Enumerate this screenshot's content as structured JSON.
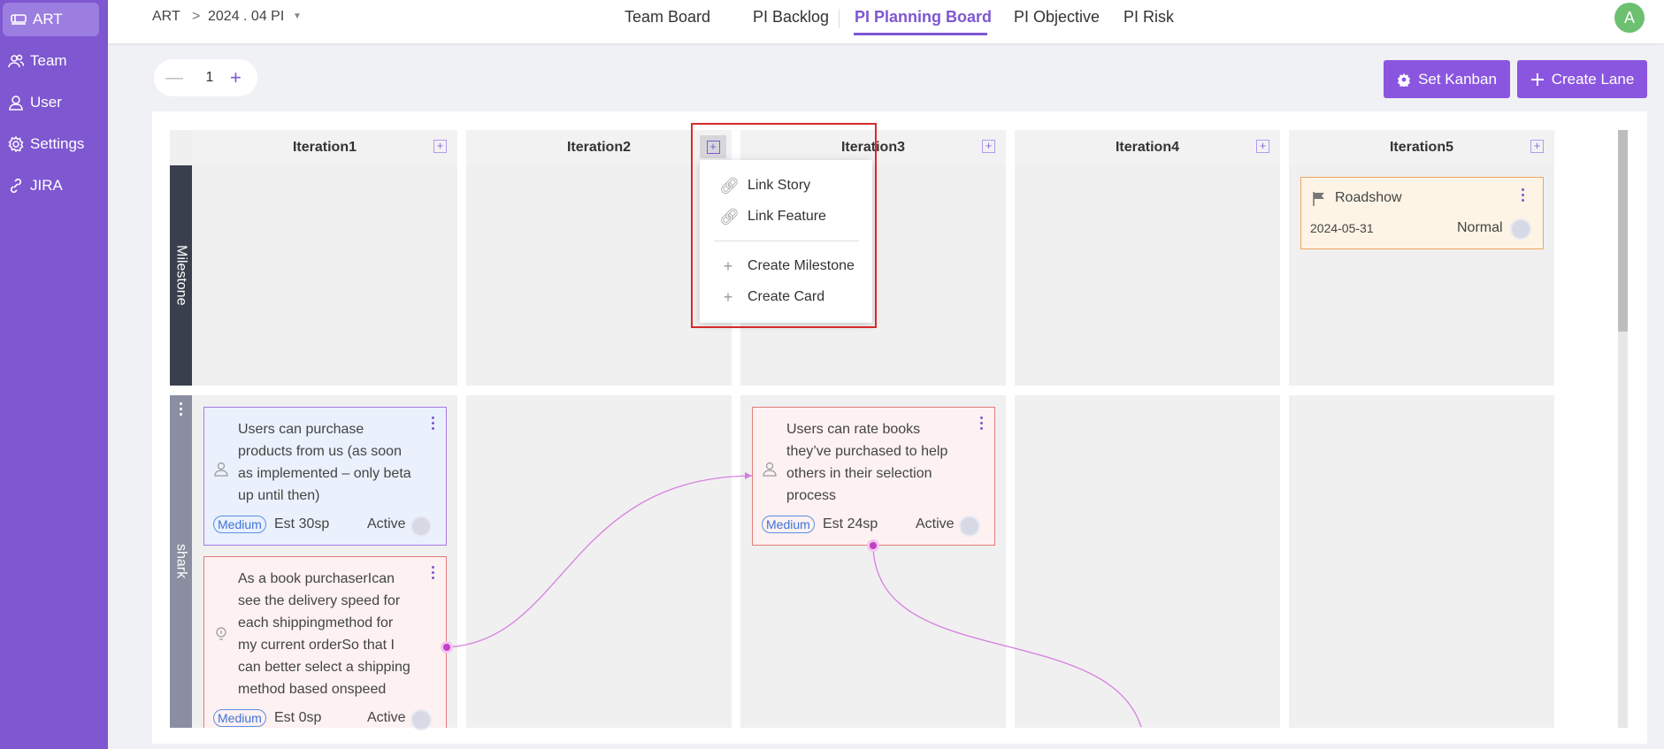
{
  "sidebar": {
    "items": [
      {
        "label": "ART",
        "icon": "train-icon"
      },
      {
        "label": "Team",
        "icon": "team-icon"
      },
      {
        "label": "User",
        "icon": "user-icon"
      },
      {
        "label": "Settings",
        "icon": "gear-icon"
      },
      {
        "label": "JIRA",
        "icon": "link-icon"
      }
    ]
  },
  "header": {
    "breadcrumb": {
      "root": "ART",
      "separator": ">",
      "current": "2024 . 04 PI"
    },
    "tabs": [
      "Team Board",
      "PI Backlog",
      "PI Planning Board",
      "PI Objective",
      "PI Risk"
    ],
    "active_tab": "PI Planning Board",
    "avatar": "A"
  },
  "toolbar": {
    "stepper_value": "1",
    "minus": "—",
    "plus": "+",
    "set_kanban": "Set Kanban",
    "create_lane": "Create Lane"
  },
  "board": {
    "iterations": [
      "Iteration1",
      "Iteration2",
      "Iteration3",
      "Iteration4",
      "Iteration5"
    ],
    "lanes": [
      "Milestone",
      "shark"
    ],
    "milestone": {
      "title": "Roadshow",
      "date": "2024-05-31",
      "priority": "Normal"
    },
    "cards": [
      {
        "text": "Users can purchase products from us (as soon as implemented – only beta up until then)",
        "badge": "Medium",
        "est": "Est 30sp",
        "status": "Active",
        "type": "user-story"
      },
      {
        "text": "As a book purchaserIcan see the delivery speed for each shippingmethod for my current orderSo that I can better select a shipping method based onspeed",
        "badge": "Medium",
        "est": "Est 0sp",
        "status": "Active",
        "type": "idea"
      },
      {
        "text": "Users can rate books they’ve purchased to help others in their selection process",
        "badge": "Medium",
        "est": "Est 24sp",
        "status": "Active",
        "type": "user-story"
      }
    ]
  },
  "context_menu": {
    "items": [
      "Link Story",
      "Link Feature",
      "Create Milestone",
      "Create Card"
    ]
  },
  "colors": {
    "accent": "#7e57d1",
    "sidebar": "#7e57d1",
    "story_card_bg": "#eaf1fd",
    "risk_card_bg": "#fdf1f1",
    "milestone_bg": "#fdf4e6",
    "dependency_line": "#d67ee0"
  }
}
